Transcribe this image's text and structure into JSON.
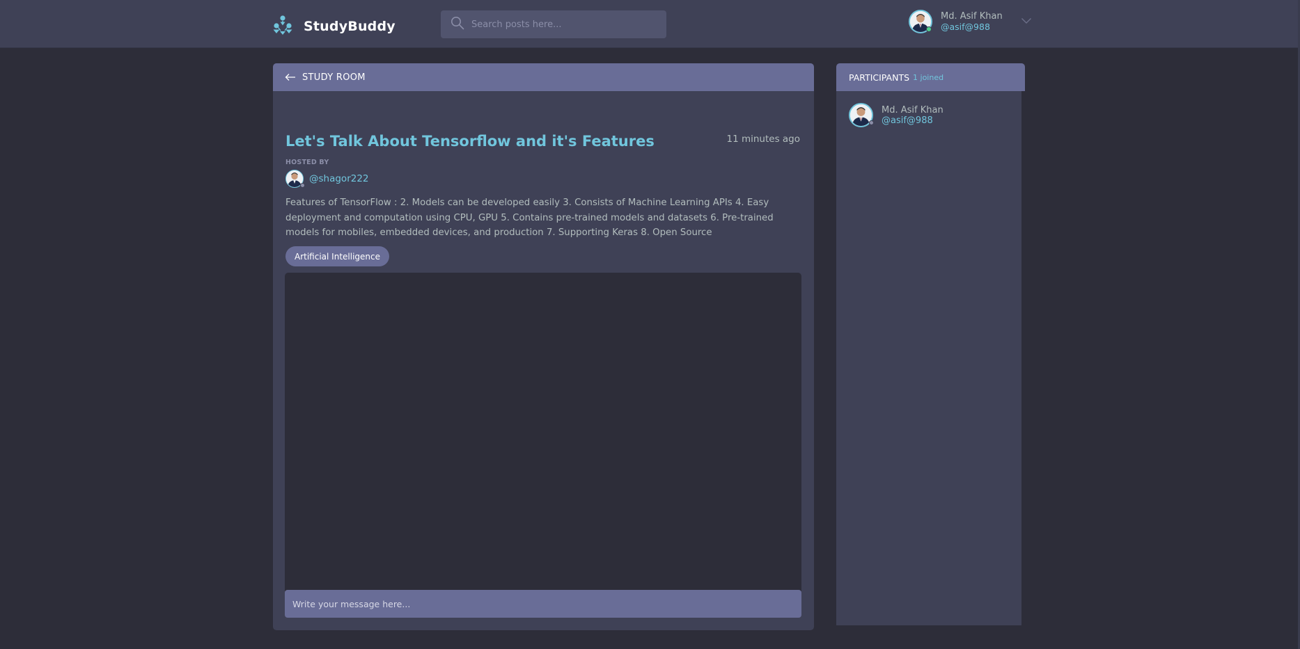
{
  "brand": {
    "name": "StudyBuddy",
    "logo_color": "#71c6dd"
  },
  "search": {
    "placeholder": "Search posts here..."
  },
  "user": {
    "name": "Md. Asif Khan",
    "handle": "@asif@988",
    "status_color": "#4fd18b"
  },
  "room": {
    "header_label": "STUDY ROOM",
    "title": "Let's Talk About Tensorflow and it's Features",
    "time": "11 minutes ago",
    "hosted_by_label": "HOSTED BY",
    "host_handle": "@shagor222",
    "host_status_color": "#8b8ea8",
    "description": "Features of TensorFlow : 2. Models can be developed easily 3. Consists of Machine Learning APIs 4. Easy deployment and computation using CPU, GPU 5. Contains pre-trained models and datasets 6. Pre-trained models for mobiles, embedded devices, and production 7. Supporting Keras 8. Open Source",
    "topic": "Artificial Intelligence",
    "message_placeholder": "Write your message here..."
  },
  "participants": {
    "title": "PARTICIPANTS",
    "count_label": "1 joined",
    "items": [
      {
        "name": "Md. Asif Khan",
        "handle": "@asif@988",
        "status_color": "#8b8ea8"
      }
    ]
  },
  "colors": {
    "background": "#2d2d39",
    "panel": "#3f4156",
    "header_accent": "#696d97",
    "accent": "#71c6dd",
    "muted_text": "#b2bdbd"
  },
  "icons": {
    "logo": "studybuddy-logo-icon",
    "search": "search-icon",
    "chevron": "chevron-down-icon",
    "back": "arrow-left-icon"
  }
}
